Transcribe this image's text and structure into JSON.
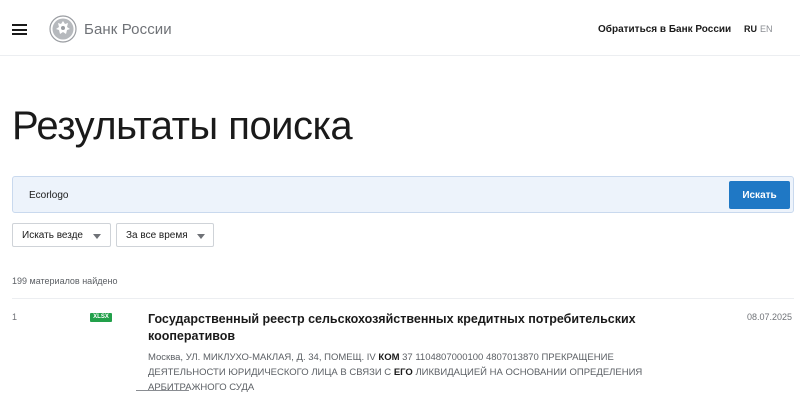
{
  "header": {
    "logo_text": "Банк России",
    "contact_link": "Обратиться в Банк России",
    "lang_ru": "RU",
    "lang_en": "EN"
  },
  "page_title": "Результаты поиска",
  "search": {
    "query": "Ecorlogo",
    "button_label": "Искать"
  },
  "filters": {
    "where": "Искать везде",
    "time": "За все время"
  },
  "results_count": "199 материалов найдено",
  "results": [
    {
      "index": "1",
      "badge": "XLSX",
      "title": "Государственный реестр сельскохозяйственных кредитных потребительских кооперативов",
      "date": "08.07.2025",
      "snippet": {
        "p1": "Москва, УЛ. МИКЛУХО-МАКЛАЯ, Д. 34, ПОМЕЩ. IV ",
        "h1": "КОМ",
        "p2": " 37 1104807000100 4807013870 ПРЕКРАЩЕНИЕ ДЕЯТЕЛЬНОСТИ ЮРИДИЧЕСКОГО ЛИЦА В СВЯЗИ С ",
        "h2": "ЕГО",
        "p3": " ЛИКВИДАЦИЕЙ НА ОСНОВАНИИ ОПРЕДЕЛЕНИЯ АРБИТРАЖНОГО СУДА"
      }
    }
  ]
}
